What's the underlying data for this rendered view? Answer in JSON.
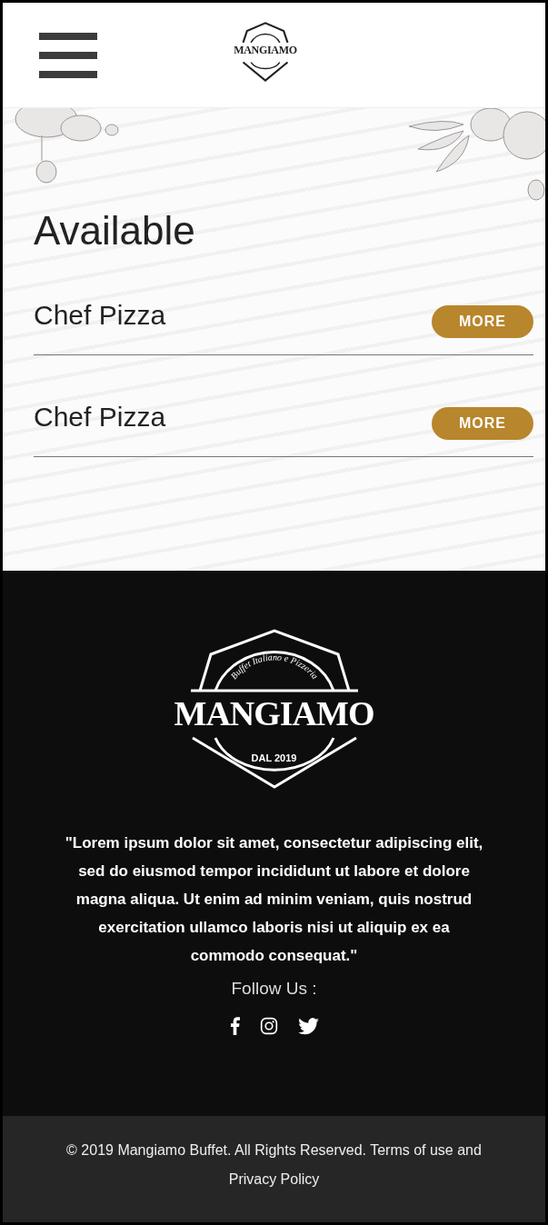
{
  "header": {
    "logo": {
      "name": "MANGIAMO"
    }
  },
  "menu": {
    "title": "Available",
    "items": [
      {
        "name": "Chef Pizza",
        "button": "MORE"
      },
      {
        "name": "Chef Pizza",
        "button": "MORE"
      }
    ]
  },
  "footer": {
    "logo": {
      "tagline": "Buffet Italiano e Pizzeria",
      "name": "MANGIAMO",
      "since": "DAL 2019"
    },
    "quote": "\"Lorem ipsum dolor sit amet, consectetur adipiscing elit, sed do eiusmod tempor incididunt ut labore et dolore magna aliqua. Ut enim ad minim veniam, quis nostrud exercitation ullamco laboris nisi ut aliquip ex ea commodo consequat.\"",
    "follow_label": "Follow Us :",
    "copyright": "© 2019 Mangiamo Buffet. All Rights Reserved. Terms of use and Privacy Policy"
  }
}
